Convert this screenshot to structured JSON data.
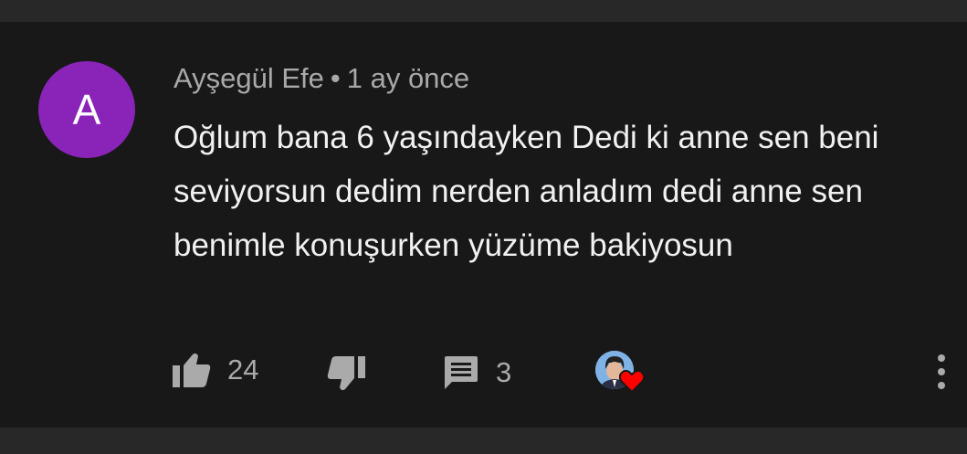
{
  "comment": {
    "avatar_letter": "A",
    "avatar_color": "#8a24b8",
    "author": "Ayşegül Efe",
    "separator": "•",
    "timestamp": "1 ay önce",
    "text": "Oğlum bana 6 yaşındayken Dedi ki anne sen beni seviyorsun dedim nerden anladım dedi anne sen benimle konuşurken yüzüme bakiyosun",
    "like_count": "24",
    "reply_count": "3",
    "heart_color": "#ff0000"
  },
  "icons": {
    "like": "thumbs-up-icon",
    "dislike": "thumbs-down-icon",
    "reply": "comment-icon",
    "creator_heart": "creator-heart-icon",
    "more": "more-vertical-icon"
  }
}
